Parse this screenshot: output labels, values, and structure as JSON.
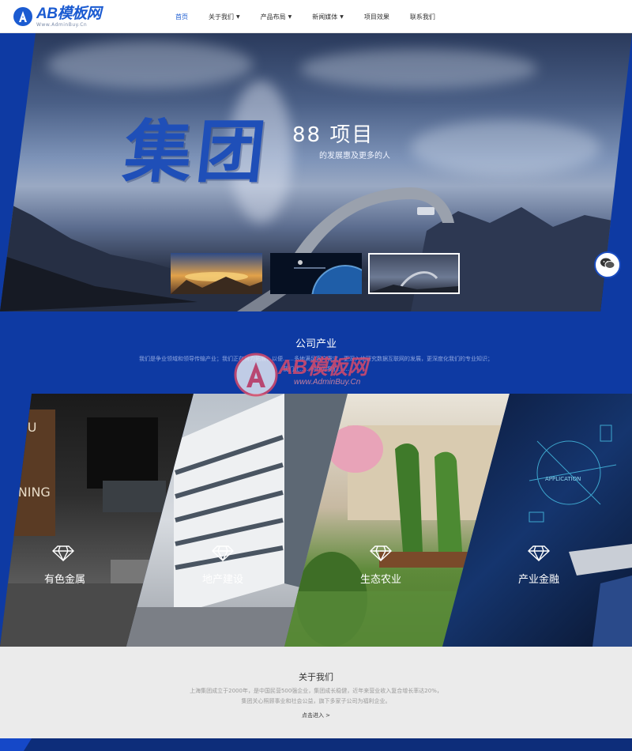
{
  "header": {
    "logo_text": "AB模板网",
    "logo_sub": "Www.AdminBuy.Cn",
    "nav": [
      {
        "label": "首页",
        "caret": false,
        "active": true
      },
      {
        "label": "关于我们",
        "caret": true
      },
      {
        "label": "产品布局",
        "caret": true
      },
      {
        "label": "新闻媒体",
        "caret": true
      },
      {
        "label": "项目效果",
        "caret": false
      },
      {
        "label": "联系我们",
        "caret": false
      }
    ]
  },
  "banner": {
    "calligraphy": "集团",
    "title": "88 项目",
    "subtitle": "的发展惠及更多的人",
    "thumbnails": [
      {
        "name": "sunrise-mountains"
      },
      {
        "name": "earth-space"
      },
      {
        "name": "bridge-night",
        "active": true
      }
    ]
  },
  "industry": {
    "title": "公司产业",
    "description_lines": [
      "我们是争业领域和领导传输产业；我们正在努力拓展，以便……多地满足客户需求，更深入地研究数据互联网的发展，更深度化我们的专业知识；",
      "我们让……的作为我们……"
    ],
    "items": [
      {
        "label": "有色金属",
        "icon": "diamond-icon"
      },
      {
        "label": "地产建设",
        "icon": "diamond-icon"
      },
      {
        "label": "生态农业",
        "icon": "diamond-icon"
      },
      {
        "label": "产业金融",
        "icon": "diamond-icon"
      }
    ]
  },
  "watermark": {
    "text": "AB模板网",
    "url": "www.AdminBuy.Cn"
  },
  "about": {
    "title": "关于我们",
    "description_lines": [
      "上海集团成立于2000年，是中国民营500强企业，集团成长稳健，近年来营业收入复合增长率达20%，",
      "集团关心照顾事业和社会公益，旗下多家子公司为福利企业。"
    ],
    "more_label": "点击进入 >"
  },
  "colors": {
    "brand_blue": "#0e3aa3",
    "link_blue": "#1b5bd1",
    "about_bg": "#ebebeb"
  }
}
